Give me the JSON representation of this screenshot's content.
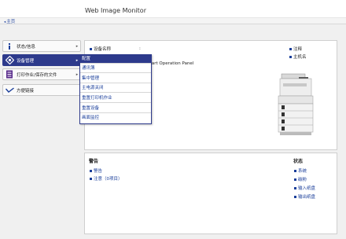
{
  "app": {
    "title": "Web Image Monitor",
    "home_link": "主页"
  },
  "sidebar": {
    "items": [
      {
        "label": "状态/信息",
        "icon": "info-icon"
      },
      {
        "label": "设备管理",
        "icon": "device-settings-icon"
      },
      {
        "label": "打印作业/保存的文件",
        "icon": "print-job-icon"
      },
      {
        "label": "方便链接",
        "icon": "link-icon"
      }
    ]
  },
  "device_menu": {
    "items": [
      "配置",
      "通讯簿",
      "集中管理",
      "主电源关闭",
      "重置打印机作业",
      "重置设备",
      "画面监控"
    ]
  },
  "info": {
    "device_name_label": "设备名称",
    "device_name_colon": ":",
    "product_name": "Smart Operation Panel",
    "comment_label": "注释",
    "host_label": "主机名"
  },
  "alerts": {
    "title": "警告",
    "items": [
      "警告",
      "注意（0项目）"
    ]
  },
  "status": {
    "title": "状态",
    "items": [
      "系统",
      "碳粉",
      "输入纸盘",
      "输出纸盘"
    ]
  },
  "colors": {
    "accent": "#2d3a8c",
    "link": "#1a3e9a"
  }
}
